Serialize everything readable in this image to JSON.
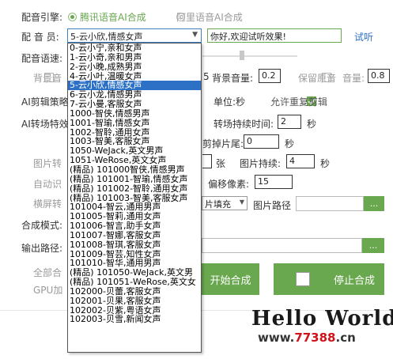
{
  "engine": {
    "label": "配音引擎:",
    "option1": "腾讯语音AI合成",
    "option2": "阿里语音AI合成"
  },
  "voice": {
    "label": "配 音 员:",
    "selected": "5-云小欣,情感女声",
    "preview_text": "你好,欢迎试听效果!",
    "listen_link": "试听"
  },
  "rate": {
    "label": "配音语速:"
  },
  "bg_row": {
    "bg_checkbox": "背景音",
    "bg_value": "5",
    "bg_volume_label": "背景音量:",
    "bg_volume_value": "0.2",
    "keep_original_label": "保留原音",
    "original_volume_label": "音量:",
    "original_volume_value": "0.8"
  },
  "ai_edit": {
    "label": "AI剪辑策略",
    "unit_label": "单位:秒",
    "allow_repeat_label": "允许重复剪辑"
  },
  "ai_trans": {
    "label": "AI转场特效",
    "duration_label": "转场持续时间:",
    "duration_value": "2",
    "duration_unit": "秒"
  },
  "tail": {
    "label": "剪掉片尾:",
    "value": "0",
    "unit": "秒"
  },
  "pic_row": {
    "checkbox": "图片转",
    "count_unit": "张",
    "duration_label": "图片持续:",
    "duration_value": "4",
    "duration_unit": "秒"
  },
  "auto_row": {
    "checkbox": "自动识",
    "offset_label": "偏移像素:",
    "offset_value": "15"
  },
  "landscape_row": {
    "checkbox": "横屏转",
    "fill_value": "片填充",
    "pic_path_label": "图片路径",
    "browse_label": "..."
  },
  "compose_mode": {
    "label": "合成模式:"
  },
  "output": {
    "label": "输出路径:",
    "browse_label": "..."
  },
  "bottom": {
    "all_label": "全部合",
    "gpu_label": "GPU加",
    "start_button": "开始合成",
    "stop_button": "停止合成"
  },
  "watermark": {
    "hello": "Hello World",
    "site_prefix": "www.",
    "site_num": "77388",
    "site_suffix": ".cn"
  },
  "colors": {
    "accent": "#6aa84f",
    "selection": "#2d71c6"
  },
  "dropdown_options": [
    "0-云小宁,亲和女声",
    "1-云小奇,亲和男声",
    "2-云小晚,成熟男声",
    "4-云小叶,温暖女声",
    "5-云小欣,情感女声",
    "6-云小龙,情感男声",
    "7-云小曼,客服女声",
    "1000-智侠,情感男声",
    "1001-智瑜,情感女声",
    "1002-智聆,通用女声",
    "1003-智美,客服女声",
    "1050-WeJack,英文男声",
    "1051-WeRose,英文女声",
    "(精品) 101000智侠,情感男声",
    "(精品) 101001-智瑜,情感女声",
    "(精品) 101002-智聆,通用女声",
    "(精品) 101003-智美,客服女声",
    "101004-智云,通用男声",
    "101005-智莉,通用女声",
    "101006-智言,助手女声",
    "101007-智娜,客服女声",
    "101008-智琪,客服女声",
    "101009-智芸,知性女声",
    "101010-智华,通用男声",
    "(精品) 101050-WeJack,英文男",
    "(精品) 101051-WeRose,英文女",
    "102000-贝蕾,客服女声",
    "102001-贝果,客服女声",
    "102002-贝紫,粤语女声",
    "102003-贝雪,新闻女声"
  ],
  "dropdown_selected_index": 4
}
